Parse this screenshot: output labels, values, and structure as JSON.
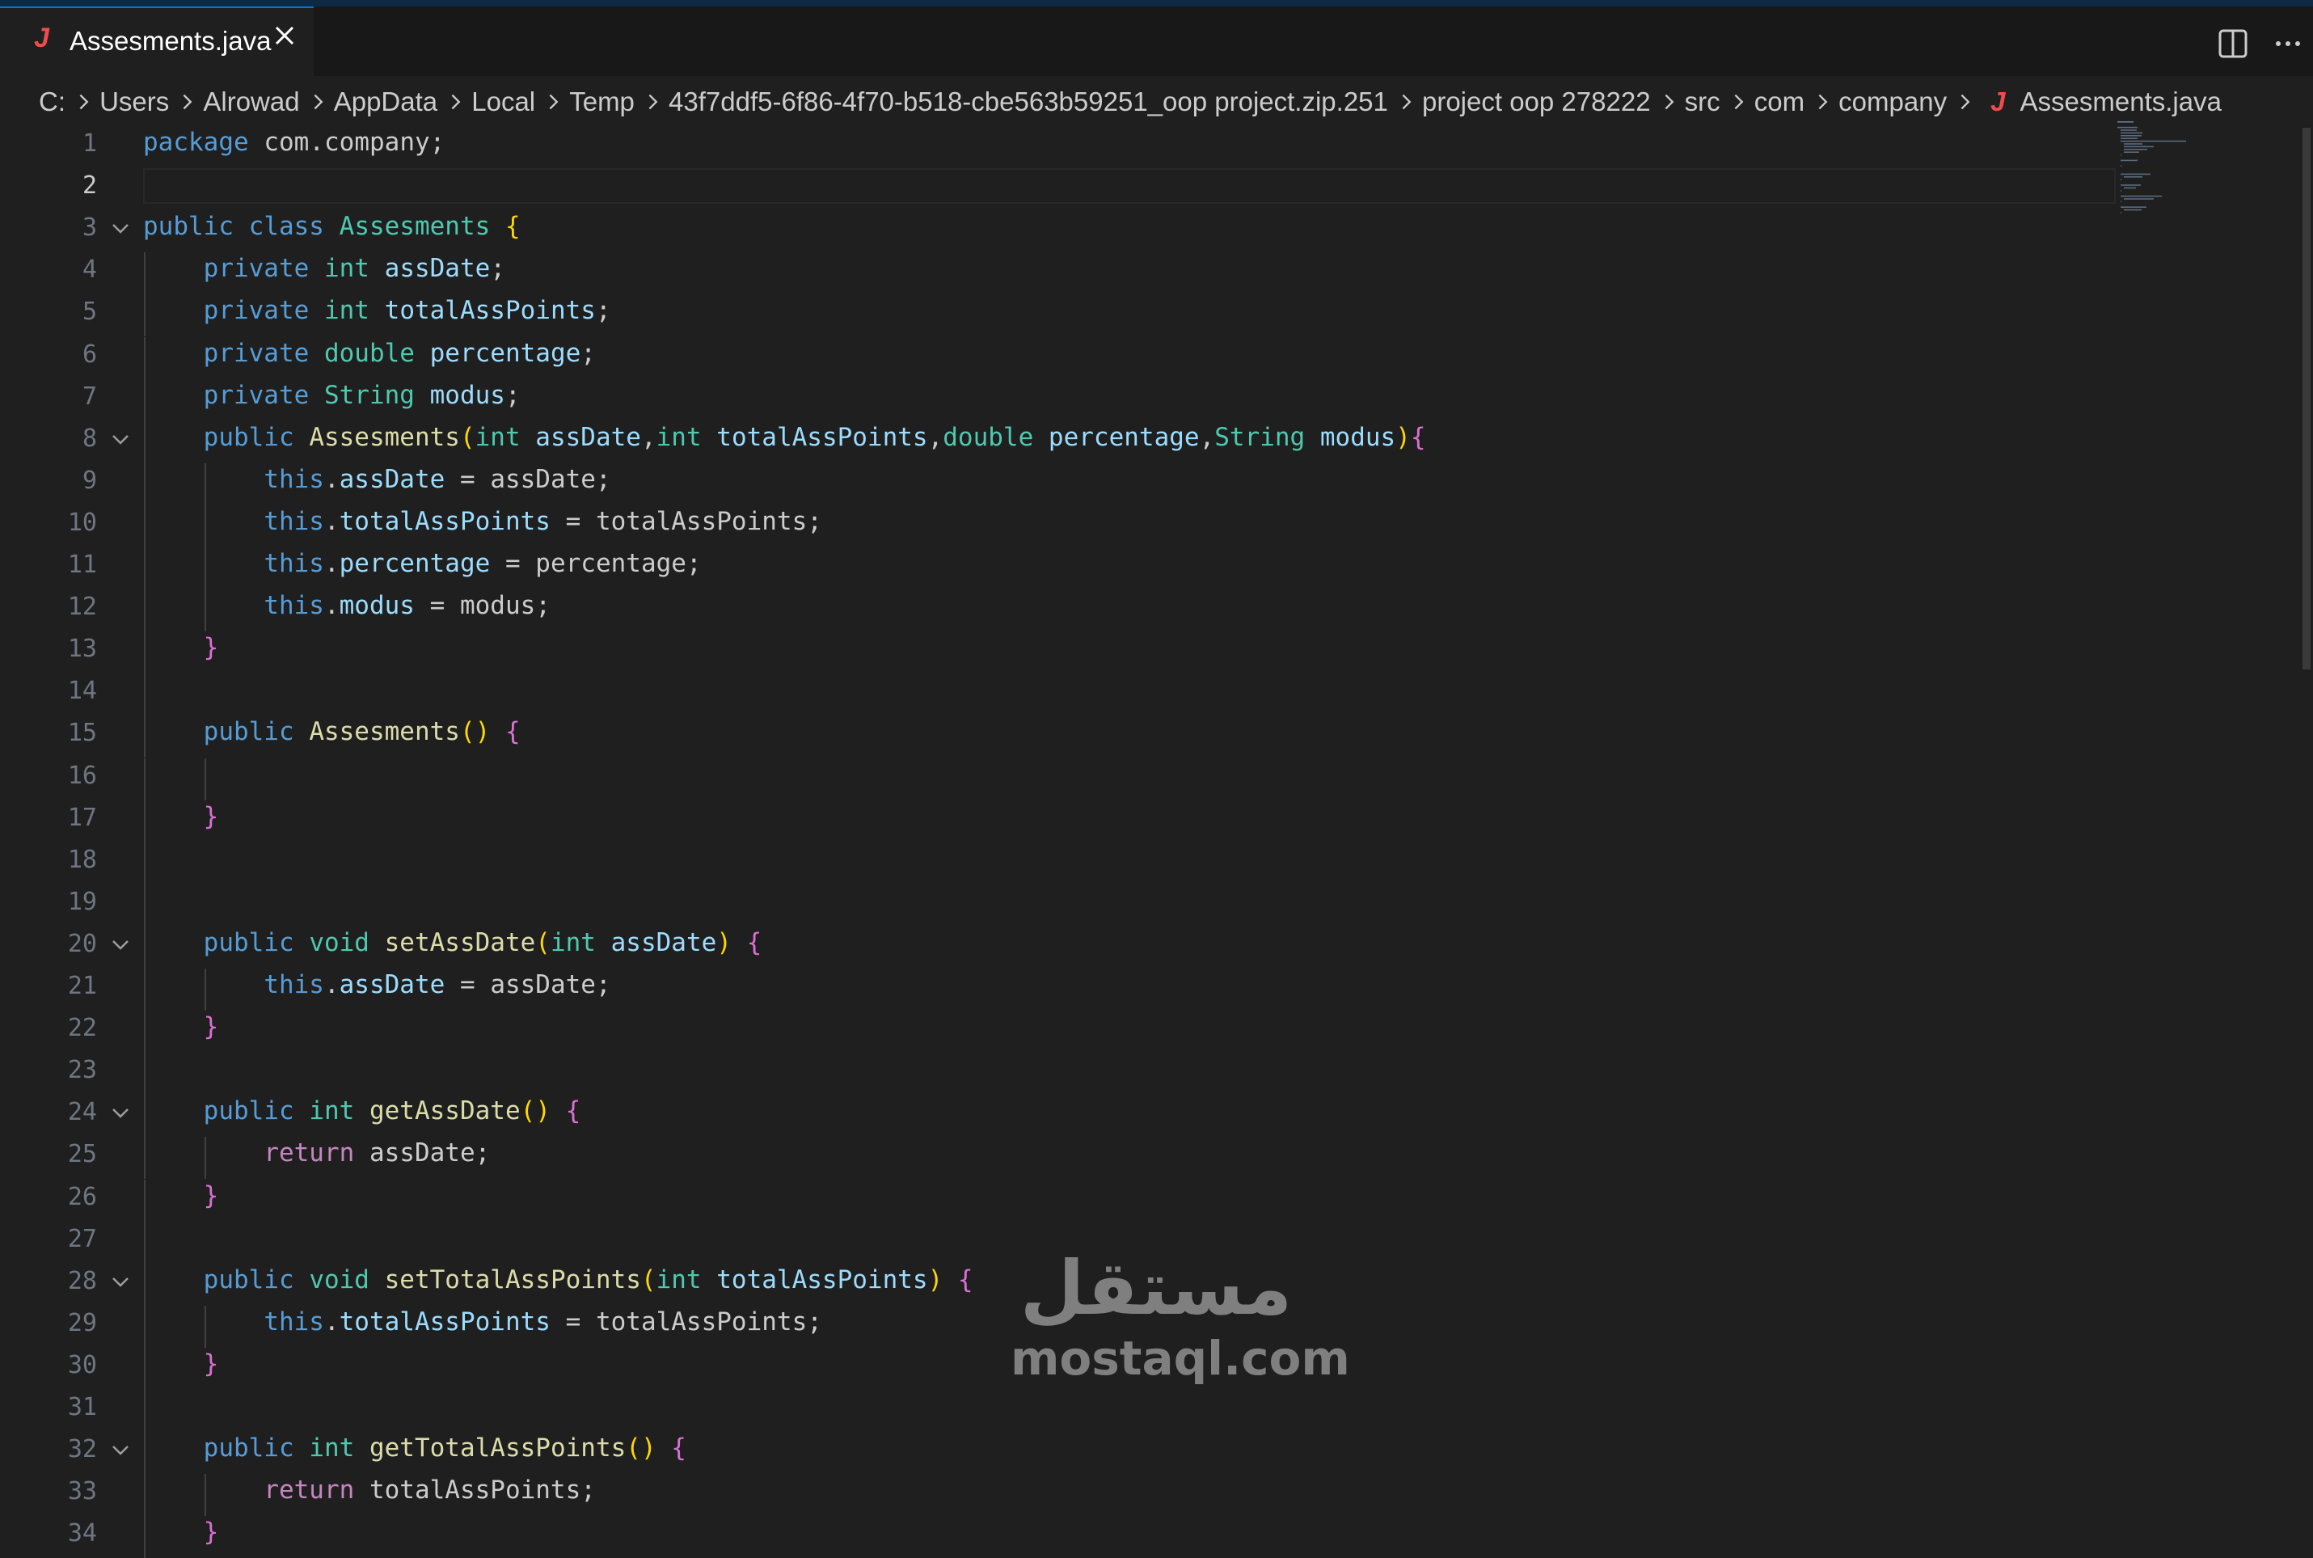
{
  "tab": {
    "label": "Assesments.java",
    "icon": "java-file-icon"
  },
  "breadcrumb": [
    "C:",
    "Users",
    "Alrowad",
    "AppData",
    "Local",
    "Temp",
    "43f7ddf5-6f86-4f70-b518-cbe563b59251_oop project.zip.251",
    "project oop 278222",
    "src",
    "com",
    "company",
    "Assesments.java"
  ],
  "editor": {
    "active_line": 2,
    "lines": [
      "package com.company;",
      "",
      "public class Assesments {",
      "    private int assDate;",
      "    private int totalAssPoints;",
      "    private double percentage;",
      "    private String modus;",
      "    public Assesments(int assDate,int totalAssPoints,double percentage,String modus){",
      "        this.assDate = assDate;",
      "        this.totalAssPoints = totalAssPoints;",
      "        this.percentage = percentage;",
      "        this.modus = modus;",
      "    }",
      "",
      "    public Assesments() {",
      "",
      "    }",
      "",
      "",
      "    public void setAssDate(int assDate) {",
      "        this.assDate = assDate;",
      "    }",
      "",
      "    public int getAssDate() {",
      "        return assDate;",
      "    }",
      "",
      "    public void setTotalAssPoints(int totalAssPoints) {",
      "        this.totalAssPoints = totalAssPoints;",
      "    }",
      "",
      "    public int getTotalAssPoints() {",
      "        return totalAssPoints;",
      "    }"
    ],
    "fold_lines": [
      3,
      8,
      20,
      24,
      28,
      32
    ]
  },
  "watermark": {
    "arabic": "مستقل",
    "latin": "mostaql.com"
  },
  "colors": {
    "background": "#1f1f1f",
    "keyword": "#569cd6",
    "control_keyword": "#c586c0",
    "type": "#4ec9b0",
    "function": "#dcdcaa",
    "variable": "#9cdcfe",
    "bracket_1": "#ffd700",
    "bracket_2": "#da70d6",
    "java_icon": "#f14c4c"
  }
}
